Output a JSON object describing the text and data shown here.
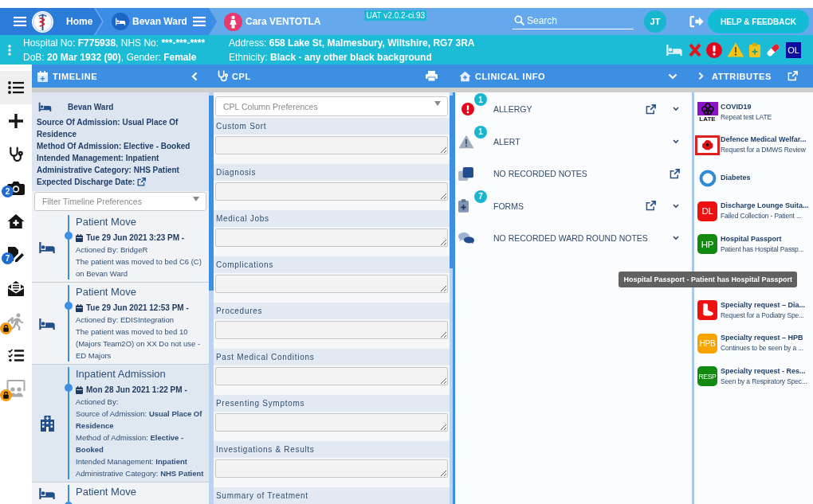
{
  "nav": {
    "home": "Home",
    "ward": "Bevan Ward",
    "patient": "Cara VENTOTLA",
    "version": "UAT v2.0.2-ci.93",
    "search": {
      "placeholder": "Search"
    },
    "user_initials": "JT",
    "help_button": "HELP & FEEDBACK"
  },
  "banner": {
    "columns": [
      [
        {
          "segments": [
            {
              "text": "Hospital No: ",
              "bold": false
            },
            {
              "text": "F775938",
              "bold": true
            },
            {
              "text": ", NHS No: ",
              "bold": false
            },
            {
              "text": "***-***-****",
              "bold": true
            }
          ]
        },
        {
          "segments": [
            {
              "text": "DoB: ",
              "bold": false
            },
            {
              "text": "20 Mar 1932 (90)",
              "bold": true
            },
            {
              "text": ", Gender: ",
              "bold": false
            },
            {
              "text": "Female",
              "bold": true
            }
          ]
        }
      ],
      [
        {
          "segments": [
            {
              "text": "Address: ",
              "bold": false
            },
            {
              "text": "658 Lake St, Malmesbury, Wiltshire, RG7 3RA",
              "bold": true
            }
          ]
        },
        {
          "segments": [
            {
              "text": "Ethnicity: ",
              "bold": false
            },
            {
              "text": "Black - any other black background",
              "bold": true
            }
          ]
        }
      ]
    ],
    "flag_label": "OL"
  },
  "sidebar": {
    "items": [
      {
        "kind": "list",
        "selected": true,
        "locked": false
      },
      {
        "kind": "add",
        "selected": false,
        "locked": false
      },
      {
        "kind": "stethoscope",
        "selected": false,
        "locked": false
      },
      {
        "kind": "camera",
        "selected": false,
        "locked": false,
        "count": "2"
      },
      {
        "kind": "house",
        "selected": false,
        "locked": false
      },
      {
        "kind": "form",
        "selected": false,
        "locked": false,
        "count": "7"
      },
      {
        "kind": "mail",
        "selected": false,
        "locked": false
      },
      {
        "kind": "walk",
        "selected": false,
        "locked": true
      },
      {
        "kind": "checklist",
        "selected": false,
        "locked": false
      },
      {
        "kind": "board",
        "selected": false,
        "locked": true
      }
    ]
  },
  "timeline": {
    "title": "TIMELINE",
    "summary": {
      "ward": "Bevan Ward",
      "lines": [
        "Source Of Admission: Usual Place Of Residence",
        "Method Of Admission: Elective - Booked",
        "Intended Management: Inpatient",
        "Administrative Category: NHS Patient"
      ],
      "discharge_label": "Expected Discharge Date:"
    },
    "filter": {
      "placeholder": "Filter Timeline Preferences"
    },
    "entries": [
      {
        "kind": "bed",
        "title": "Patient Move",
        "date": "Tue 29 Jun 2021 3:23 PM -",
        "lines": [
          "Actioned By: BridgeR",
          "The patient was moved to bed C6 (C) on Bevan Ward"
        ]
      },
      {
        "kind": "bed",
        "title": "Patient Move",
        "date": "Tue 29 Jun 2021 12:53 PM -",
        "lines": [
          "Actioned By: EDISIntegration",
          "The patient was moved to bed 10 (Majors Team2O) on XX Do not use - ED Majors"
        ]
      },
      {
        "kind": "hospital",
        "title": "Inpatient Admission",
        "date": "Mon 28 Jun 2021 1:22 PM -",
        "lines": [
          "Actioned By:",
          "Source of Admission: **Usual Place Of Residence**",
          "Method of Admission: **Elective - Booked**",
          "Intended Management: **Inpatient**",
          "Administrative Category: **NHS Patient**"
        ]
      },
      {
        "kind": "bed",
        "title": "Patient Move"
      }
    ]
  },
  "cpl": {
    "title": "CPL",
    "preferences": {
      "placeholder": "CPL Column Preferences"
    },
    "sections": [
      {
        "label": "Custom Sort"
      },
      {
        "label": "Diagnosis"
      },
      {
        "label": "Medical Jobs"
      },
      {
        "label": "Complications"
      },
      {
        "label": "Procedures"
      },
      {
        "label": "Past Medical Conditions"
      },
      {
        "label": "Presenting Symptoms"
      },
      {
        "label": "Investigations & Results"
      },
      {
        "label": "Summary of Treatment"
      }
    ]
  },
  "clinical": {
    "title": "CLINICAL INFO",
    "items": [
      {
        "kind": "allergy",
        "label": "ALLERGY",
        "count": "1",
        "external_link": true,
        "expandable": true
      },
      {
        "kind": "alert",
        "label": "ALERT",
        "count": "1",
        "external_link": false,
        "expandable": true
      },
      {
        "kind": "notes",
        "label": "NO RECORDED NOTES",
        "external_link": true,
        "expandable": false
      },
      {
        "kind": "forms",
        "label": "FORMS",
        "count": "7",
        "external_link": true,
        "expandable": true
      },
      {
        "kind": "ward_round",
        "label": "NO RECORDED WARD ROUND NOTES",
        "external_link": false,
        "expandable": true
      }
    ]
  },
  "attributes": {
    "title": "ATTRIBUTES",
    "items": [
      {
        "kind": "covid",
        "tile_text": "LATE",
        "title": "COVID19",
        "subtitle": "Repeat test LATE"
      },
      {
        "kind": "poppy",
        "title": "Defence Medical Welfar...",
        "subtitle": "Request for a DMWS Review"
      },
      {
        "kind": "ring",
        "title": "Diabetes"
      },
      {
        "kind": "tile",
        "tile_text": "DL",
        "color": "#ee1111",
        "title": "Discharge Lounge Suita...",
        "subtitle": "Failed Collection - Patient ..."
      },
      {
        "kind": "tile",
        "tile_text": "HP",
        "color": "#128a12",
        "title": "Hospital Passport",
        "subtitle": "Patient has Hospital Passp...",
        "tooltip": "Hospital Passport - Patient has Hospital Passport"
      },
      {
        "kind": "foot",
        "color": "#ee1111",
        "title": "Specialty request – Dia...",
        "subtitle": "Request for a Podiatry Spe..."
      },
      {
        "kind": "tile",
        "tile_text": "HPB",
        "color": "#f7a400",
        "title": "Specialty request – HPB",
        "subtitle": "Continues to be seen by a ..."
      },
      {
        "kind": "tile",
        "tile_text": "RESP",
        "color": "#128a12",
        "title": "Specialty request - Res...",
        "subtitle": "Seen by a Respiratory Spec..."
      }
    ]
  }
}
